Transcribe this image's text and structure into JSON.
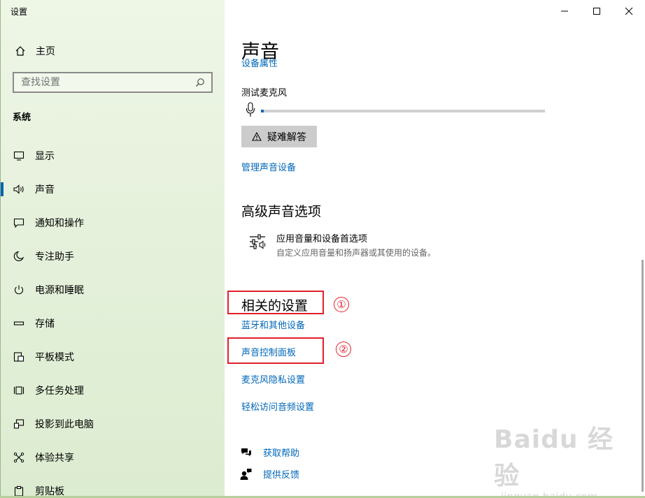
{
  "window": {
    "title": "设置",
    "controls": {
      "minimize": "—",
      "maximize": "☐",
      "close": "✕"
    }
  },
  "sidebar": {
    "home_label": "主页",
    "search_placeholder": "查找设置",
    "section_label": "系统",
    "items": [
      {
        "label": "显示",
        "icon": "display-icon",
        "active": false
      },
      {
        "label": "声音",
        "icon": "speaker-icon",
        "active": true
      },
      {
        "label": "通知和操作",
        "icon": "notification-icon",
        "active": false
      },
      {
        "label": "专注助手",
        "icon": "moon-icon",
        "active": false
      },
      {
        "label": "电源和睡眠",
        "icon": "power-icon",
        "active": false
      },
      {
        "label": "存储",
        "icon": "storage-icon",
        "active": false
      },
      {
        "label": "平板模式",
        "icon": "tablet-icon",
        "active": false
      },
      {
        "label": "多任务处理",
        "icon": "multitask-icon",
        "active": false
      },
      {
        "label": "投影到此电脑",
        "icon": "project-icon",
        "active": false
      },
      {
        "label": "体验共享",
        "icon": "share-icon",
        "active": false
      },
      {
        "label": "剪贴板",
        "icon": "clipboard-icon",
        "active": false
      }
    ]
  },
  "main": {
    "page_title": "声音",
    "clipped_link": "设备属性",
    "mic_test": {
      "label": "测试麦克风",
      "level": 0.01
    },
    "troubleshoot_label": "疑难解答",
    "manage_devices_link": "管理声音设备",
    "advanced": {
      "title": "高级声音选项",
      "pref_title": "应用音量和设备首选项",
      "pref_desc": "自定义应用音量和扬声器或其使用的设备。"
    },
    "related": {
      "title": "相关的设置",
      "links": [
        "蓝牙和其他设备",
        "声音控制面板",
        "麦克风隐私设置",
        "轻松访问音频设置"
      ]
    },
    "help": {
      "get_help": "获取帮助",
      "feedback": "提供反馈"
    }
  },
  "annotations": {
    "marker1": "①",
    "marker2": "②",
    "color": "#e0202a"
  },
  "watermark": {
    "line1": "Baidu 经验",
    "line2": "jingyan.baidu.com"
  },
  "colors": {
    "accent": "#0067b8",
    "sidebar_bg": "#e6f1dc",
    "button_bg": "#cccccc"
  }
}
